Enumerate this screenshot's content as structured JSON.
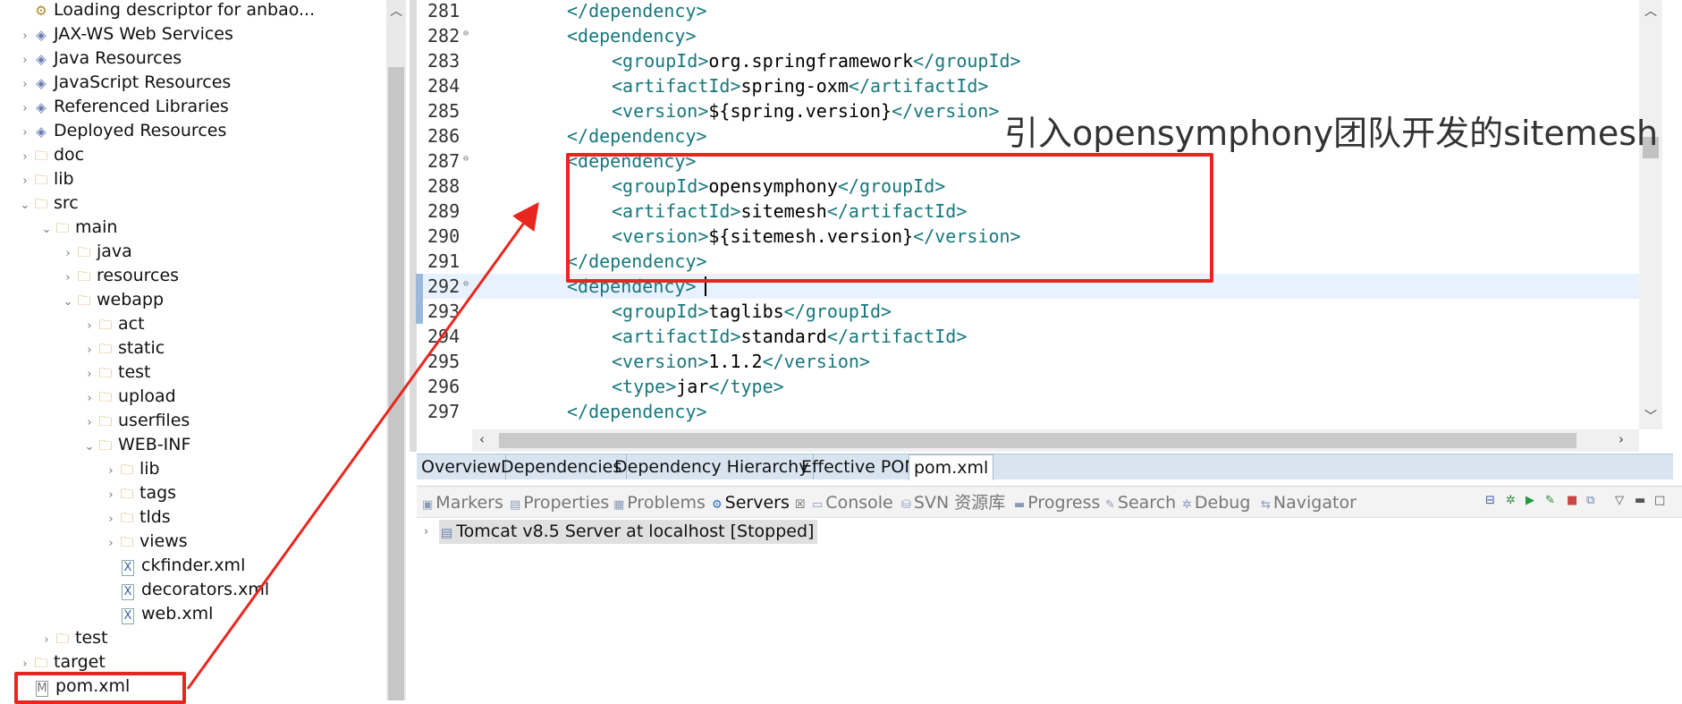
{
  "explorer": {
    "items": [
      {
        "label": "Loading descriptor for anbao...",
        "icon": "descriptor-icon",
        "twisty": ""
      },
      {
        "label": "JAX-WS Web Services",
        "icon": "web-services-icon",
        "twisty": "›"
      },
      {
        "label": "Java Resources",
        "icon": "java-resources-icon",
        "twisty": "›"
      },
      {
        "label": "JavaScript Resources",
        "icon": "javascript-resources-icon",
        "twisty": "›"
      },
      {
        "label": "Referenced Libraries",
        "icon": "library-icon",
        "twisty": "›"
      },
      {
        "label": "Deployed Resources",
        "icon": "deployed-resources-icon",
        "twisty": "›"
      },
      {
        "label": "doc",
        "icon": "folder-icon",
        "twisty": "›"
      },
      {
        "label": "lib",
        "icon": "folder-icon",
        "twisty": "›"
      },
      {
        "label": "src",
        "icon": "folder-icon",
        "twisty": "⌄"
      },
      {
        "label": "main",
        "icon": "folder-icon",
        "twisty": "⌄"
      },
      {
        "label": "java",
        "icon": "folder-icon",
        "twisty": "›"
      },
      {
        "label": "resources",
        "icon": "folder-icon",
        "twisty": "›"
      },
      {
        "label": "webapp",
        "icon": "folder-icon",
        "twisty": "⌄"
      },
      {
        "label": "act",
        "icon": "folder-icon",
        "twisty": "›"
      },
      {
        "label": "static",
        "icon": "folder-icon",
        "twisty": "›"
      },
      {
        "label": "test",
        "icon": "folder-icon",
        "twisty": "›"
      },
      {
        "label": "upload",
        "icon": "folder-icon",
        "twisty": "›"
      },
      {
        "label": "userfiles",
        "icon": "folder-icon",
        "twisty": "›"
      },
      {
        "label": "WEB-INF",
        "icon": "folder-icon",
        "twisty": "⌄"
      },
      {
        "label": "lib",
        "icon": "folder-icon",
        "twisty": "›"
      },
      {
        "label": "tags",
        "icon": "folder-icon",
        "twisty": "›"
      },
      {
        "label": "tlds",
        "icon": "folder-icon",
        "twisty": "›"
      },
      {
        "label": "views",
        "icon": "folder-icon",
        "twisty": "›"
      },
      {
        "label": "ckfinder.xml",
        "icon": "xml-file-icon",
        "twisty": ""
      },
      {
        "label": "decorators.xml",
        "icon": "xml-file-icon",
        "twisty": ""
      },
      {
        "label": "web.xml",
        "icon": "xml-file-icon",
        "twisty": ""
      },
      {
        "label": "test",
        "icon": "folder-icon",
        "twisty": "›"
      },
      {
        "label": "target",
        "icon": "folder-icon",
        "twisty": "›"
      },
      {
        "label": "pom.xml",
        "icon": "pom-file-icon",
        "twisty": ""
      }
    ]
  },
  "editor": {
    "lines": [
      {
        "num": "281",
        "fold": "",
        "open": "</dependency>",
        "text": "",
        "close": ""
      },
      {
        "num": "282",
        "fold": "⊖",
        "open": "<dependency>",
        "text": "",
        "close": ""
      },
      {
        "num": "283",
        "fold": "",
        "open": "<groupId>",
        "text": "org.springframework",
        "close": "</groupId>"
      },
      {
        "num": "284",
        "fold": "",
        "open": "<artifactId>",
        "text": "spring-oxm",
        "close": "</artifactId>"
      },
      {
        "num": "285",
        "fold": "",
        "open": "<version>",
        "text": "${spring.version}",
        "close": "</version>"
      },
      {
        "num": "286",
        "fold": "",
        "open": "</dependency>",
        "text": "",
        "close": ""
      },
      {
        "num": "287",
        "fold": "⊖",
        "open": "<dependency>",
        "text": "",
        "close": ""
      },
      {
        "num": "288",
        "fold": "",
        "open": "<groupId>",
        "text": "opensymphony",
        "close": "</groupId>"
      },
      {
        "num": "289",
        "fold": "",
        "open": "<artifactId>",
        "text": "sitemesh",
        "close": "</artifactId>"
      },
      {
        "num": "290",
        "fold": "",
        "open": "<version>",
        "text": "${sitemesh.version}",
        "close": "</version>"
      },
      {
        "num": "291",
        "fold": "",
        "open": "</dependency>",
        "text": "",
        "close": ""
      },
      {
        "num": "292",
        "fold": "⊖",
        "open": "<dependency>",
        "text": "",
        "close": ""
      },
      {
        "num": "293",
        "fold": "",
        "open": "<groupId>",
        "text": "taglibs",
        "close": "</groupId>"
      },
      {
        "num": "294",
        "fold": "",
        "open": "<artifactId>",
        "text": "standard",
        "close": "</artifactId>"
      },
      {
        "num": "295",
        "fold": "",
        "open": "<version>",
        "text": "1.1.2",
        "close": "</version>"
      },
      {
        "num": "296",
        "fold": "",
        "open": "<type>",
        "text": "jar",
        "close": "</type>"
      },
      {
        "num": "297",
        "fold": "",
        "open": "</dependency>",
        "text": "",
        "close": ""
      }
    ],
    "current_line": "292"
  },
  "editor_tabs": [
    "Overview",
    "Dependencies",
    "Dependency Hierarchy",
    "Effective POM",
    "pom.xml"
  ],
  "active_editor_tab": "pom.xml",
  "views": {
    "tabs": [
      {
        "label": "Markers",
        "icon": "markers-icon"
      },
      {
        "label": "Properties",
        "icon": "properties-icon"
      },
      {
        "label": "Problems",
        "icon": "problems-icon"
      },
      {
        "label": "Servers",
        "icon": "servers-icon",
        "close": "☒"
      },
      {
        "label": "Console",
        "icon": "console-icon"
      },
      {
        "label": "SVN 资源库",
        "icon": "svn-icon"
      },
      {
        "label": "Progress",
        "icon": "progress-icon"
      },
      {
        "label": "Search",
        "icon": "search-icon"
      },
      {
        "label": "Debug",
        "icon": "debug-icon"
      },
      {
        "label": "Navigator",
        "icon": "navigator-icon"
      }
    ],
    "active_tab": "Servers",
    "server_entry": "Tomcat v8.5 Server at localhost  [Stopped]"
  },
  "annotation": {
    "text": "引入opensymphony团队开发的sitemesh",
    "color": "#e8261f"
  }
}
